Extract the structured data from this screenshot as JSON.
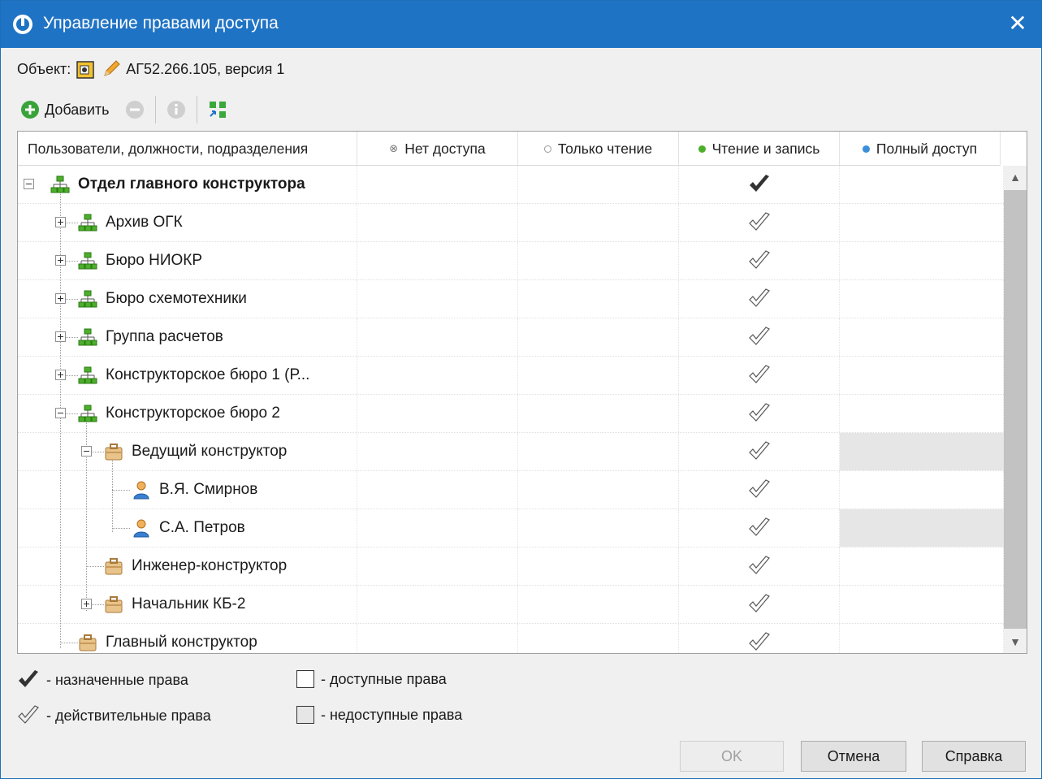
{
  "window": {
    "title": "Управление правами доступа",
    "close_glyph": "✕"
  },
  "object": {
    "label": "Объект:",
    "name": "АГ52.266.105, версия 1"
  },
  "toolbar": {
    "add_label": "Добавить"
  },
  "columns": [
    "Пользователи, должности, подразделения",
    "Нет доступа",
    "Только чтение",
    "Чтение и запись",
    "Полный доступ"
  ],
  "column_colors": {
    "no_access": "#888888",
    "read_only": "#9a9a9a",
    "read_write": "#4caf2a",
    "full": "#3a8fd8"
  },
  "rows": [
    {
      "label": "Отдел главного конструктора",
      "type": "dept",
      "mark": "assigned"
    },
    {
      "label": "Архив ОГК",
      "type": "dept",
      "mark": "effective"
    },
    {
      "label": "Бюро НИОКР",
      "type": "dept",
      "mark": "effective"
    },
    {
      "label": "Бюро схемотехники",
      "type": "dept",
      "mark": "effective"
    },
    {
      "label": "Группа расчетов",
      "type": "dept",
      "mark": "effective"
    },
    {
      "label": "Конструкторское бюро 1 (Р...",
      "type": "dept",
      "mark": "effective"
    },
    {
      "label": "Конструкторское бюро 2",
      "type": "dept",
      "mark": "effective"
    },
    {
      "label": "Ведущий конструктор",
      "type": "position",
      "mark": "effective"
    },
    {
      "label": "В.Я. Смирнов",
      "type": "user",
      "mark": "effective"
    },
    {
      "label": "С.А. Петров",
      "type": "user",
      "mark": "effective"
    },
    {
      "label": "Инженер-конструктор",
      "type": "position",
      "mark": "effective"
    },
    {
      "label": "Начальник КБ-2",
      "type": "position",
      "mark": "effective"
    },
    {
      "label": "Главный конструктор",
      "type": "position",
      "mark": "effective"
    }
  ],
  "legend": {
    "assigned": "- назначенные права",
    "effective": "- действительные права",
    "available": "- доступные права",
    "unavailable": "- недоступные права"
  },
  "buttons": {
    "ok": "OK",
    "cancel": "Отмена",
    "help": "Справка"
  }
}
